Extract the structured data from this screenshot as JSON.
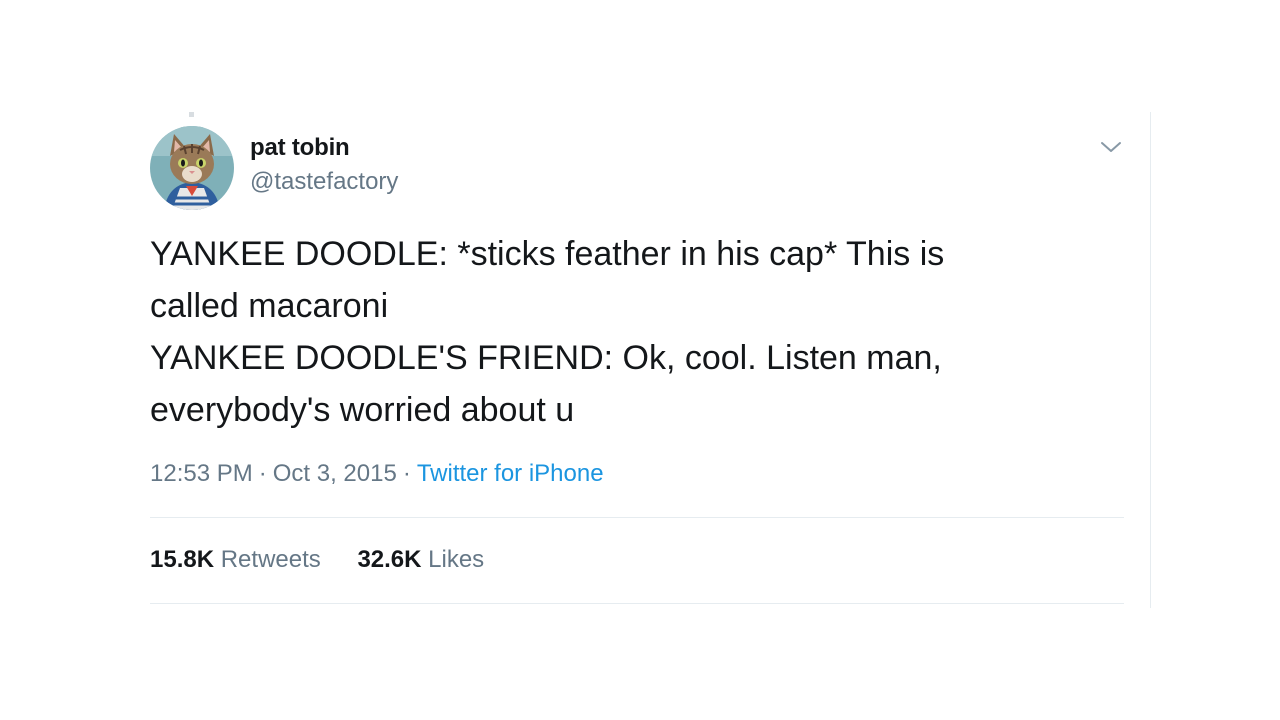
{
  "tweet": {
    "author": {
      "name": "pat tobin",
      "handle": "@tastefactory",
      "avatar_icon": "kitten-avatar-icon"
    },
    "text_lines": [
      "YANKEE DOODLE: *sticks feather in his cap* This is",
      "called macaroni",
      "YANKEE DOODLE'S FRIEND: Ok, cool. Listen man,",
      "everybody's worried about u"
    ],
    "meta": {
      "time": "12:53 PM",
      "separator": "·",
      "date": "Oct 3, 2015",
      "source": "Twitter for iPhone"
    },
    "stats": {
      "retweets_count": "15.8K",
      "retweets_label": "Retweets",
      "likes_count": "32.6K",
      "likes_label": "Likes"
    },
    "menu_icon": "chevron-down-icon"
  },
  "colors": {
    "text_primary": "#14171a",
    "text_secondary": "#657786",
    "link": "#1b95e0",
    "divider": "#e6ecf0"
  }
}
